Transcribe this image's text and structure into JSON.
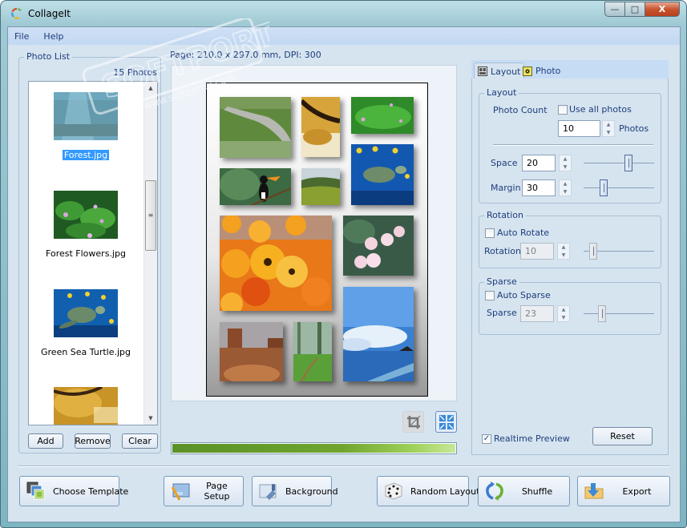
{
  "window": {
    "title": "CollageIt",
    "controls": {
      "minimize": "—",
      "maximize": "□",
      "close": "X"
    }
  },
  "menu": [
    {
      "label": "File"
    },
    {
      "label": "Help"
    }
  ],
  "photo_list": {
    "title": "Photo List",
    "count_label": "15 Photos",
    "items": [
      {
        "label": "Forest.jpg",
        "selected": true,
        "icon": "forest-thumbnail"
      },
      {
        "label": "Forest Flowers.jpg",
        "selected": false,
        "icon": "forest-flowers-thumbnail"
      },
      {
        "label": "Green Sea Turtle.jpg",
        "selected": false,
        "icon": "sea-turtle-thumbnail"
      },
      {
        "label": "",
        "selected": false,
        "icon": "autumn-tree-thumbnail"
      }
    ],
    "buttons": {
      "add": "Add",
      "remove": "Remove",
      "clear": "Clear"
    }
  },
  "preview": {
    "page_info": "Page: 210.0 x 297.0 mm, DPI: 300",
    "photos": [
      "stream-meadow",
      "autumn-tree",
      "forest-flowers",
      "toucan",
      "green-hills",
      "sea-turtle",
      "orange-daisies",
      "plumeria",
      "desert-mesa",
      "forest-path",
      "ocean-pier"
    ],
    "progress_percent": 100
  },
  "tabs": [
    {
      "label": "Layout",
      "active": true,
      "icon": "layout-icon"
    },
    {
      "label": "Photo",
      "active": false,
      "icon": "photo-icon"
    }
  ],
  "layout": {
    "group_title": "Layout",
    "photo_count_label": "Photo Count",
    "use_all_photos_label": "Use all photos",
    "use_all_photos_checked": false,
    "photo_count_value": "10",
    "photos_unit": "Photos",
    "space_label": "Space",
    "space_value": "20",
    "space_slider_fraction": 0.64,
    "margin_label": "Margin",
    "margin_value": "30",
    "margin_slider_fraction": 0.28
  },
  "rotation": {
    "group_title": "Rotation",
    "auto_rotate_label": "Auto Rotate",
    "auto_rotate_checked": false,
    "rotation_label": "Rotation",
    "rotation_value": "10",
    "rotation_slider_fraction": 0.14
  },
  "sparse": {
    "group_title": "Sparse",
    "auto_sparse_label": "Auto Sparse",
    "auto_sparse_checked": false,
    "sparse_label": "Sparse",
    "sparse_value": "23",
    "sparse_slider_fraction": 0.26
  },
  "realtime_preview": {
    "label": "Realtime Preview",
    "checked": true,
    "check_glyph": "✓"
  },
  "reset_label": "Reset",
  "bottom_buttons": {
    "choose_template": "Choose Template",
    "page_setup": "Page Setup",
    "background": "Background",
    "random_layout": "Random Layout",
    "shuffle": "Shuffle",
    "export": "Export"
  },
  "watermark": {
    "text": "SOFTPORTAL",
    "url": "www.softportal.com",
    "tm": "TM"
  }
}
